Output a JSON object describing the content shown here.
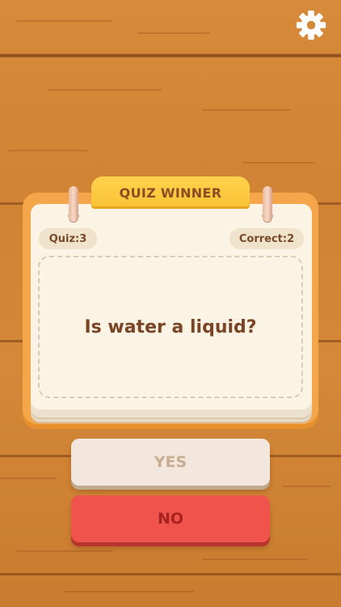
{
  "header": {
    "settings_icon": "gear-icon"
  },
  "card": {
    "title": "QUIZ WINNER",
    "quiz_label": "Quiz:3",
    "correct_label": "Correct:2",
    "question": "Is water a liquid?"
  },
  "answers": {
    "yes_label": "YES",
    "no_label": "NO"
  },
  "colors": {
    "wood": "#d68a3a",
    "card_orange": "#f6a64a",
    "tab_yellow": "#ffd24d",
    "paper": "#fbf3e3",
    "text_brown": "#7a4426",
    "yes_button": "#f3e7dd",
    "no_button": "#f0524c"
  }
}
